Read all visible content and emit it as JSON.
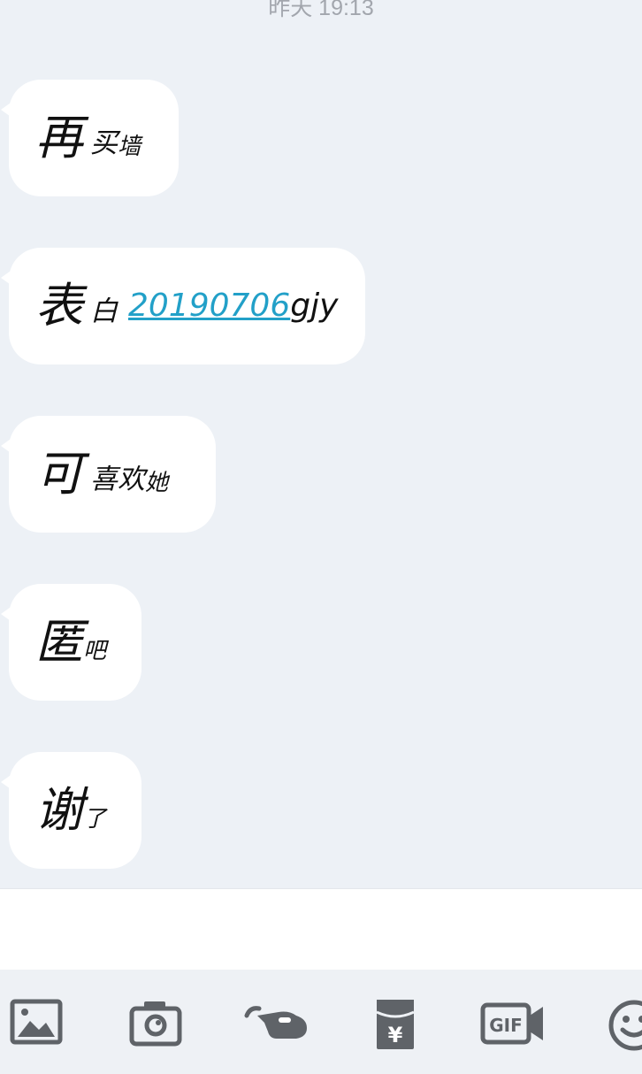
{
  "timestamp": "昨天 19:13",
  "messages": [
    {
      "big": "再",
      "mid": "买",
      "small": "墙"
    },
    {
      "big": "表",
      "mid": "白",
      "link": "20190706",
      "tail": "gjy"
    },
    {
      "big": "可",
      "mid": "喜欢",
      "small": "她"
    },
    {
      "big": "匿",
      "mid": "",
      "small": "吧"
    },
    {
      "big": "谢",
      "mid": "",
      "small": "了"
    }
  ],
  "toolbar": {
    "icons": [
      "image-icon",
      "camera-icon",
      "poke-icon",
      "red-packet-icon",
      "gif-icon",
      "emoji-icon"
    ],
    "gif_label": "GIF",
    "red_packet_label": "¥"
  },
  "colors": {
    "background": "#edf1f6",
    "bubble": "#ffffff",
    "link": "#22a0c8",
    "icon": "#5f6368"
  }
}
